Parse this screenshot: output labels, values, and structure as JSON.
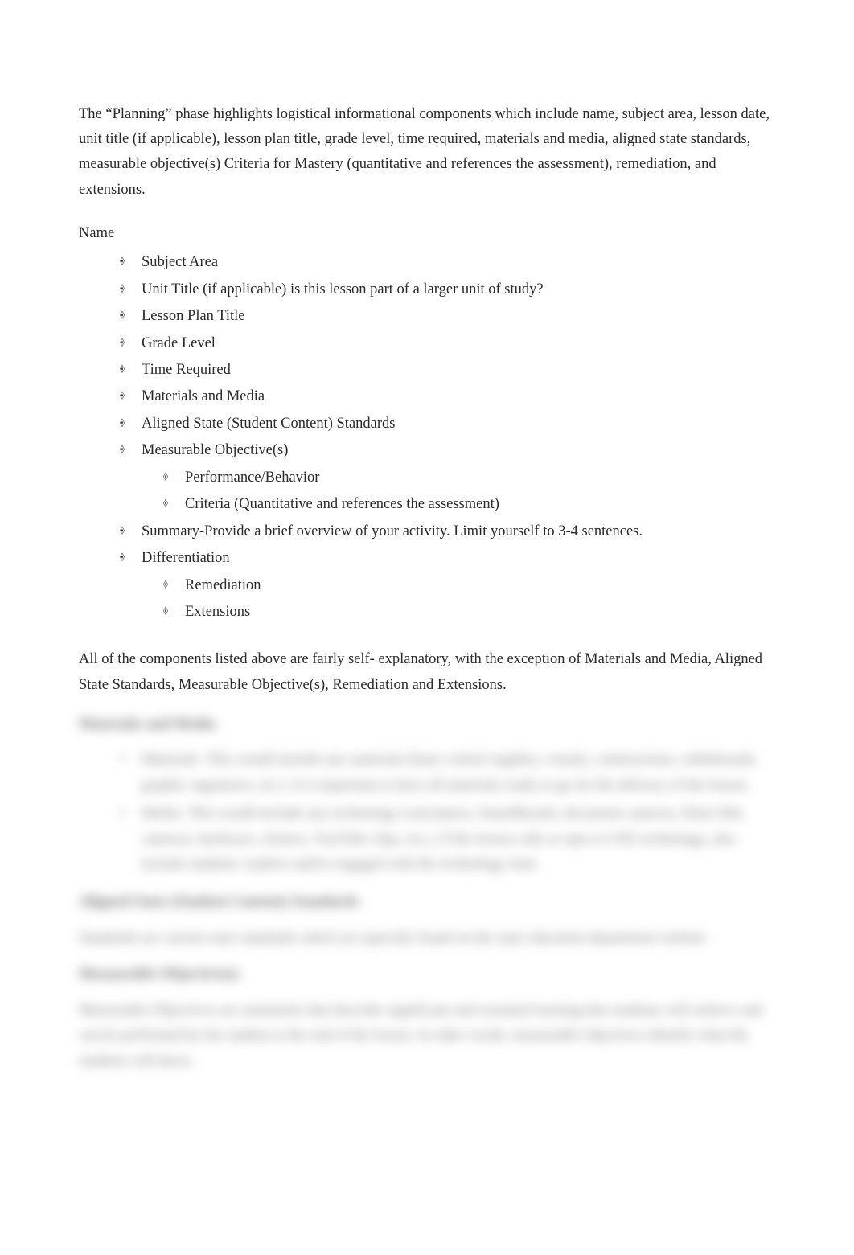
{
  "intro": "The “Planning” phase highlights logistical informational components which include name, subject area, lesson date, unit title (if applicable), lesson plan title, grade level, time required, materials and media, aligned state standards, measurable objective(s) Criteria for Mastery (quantitative and references the assessment), remediation, and extensions.",
  "name_label": "Name",
  "list1": {
    "item0": "Subject Area",
    "item1": "Unit Title (if applicable) is this lesson part of a larger unit of study?",
    "item2": "Lesson Plan Title",
    "item3": "Grade Level",
    "item4": "Time Required",
    "item5": "Materials and Media",
    "item6": "Aligned State (Student Content) Standards",
    "item7": "Measurable Objective(s)",
    "item7_sub": {
      "s0": "Performance/Behavior",
      "s1": "Criteria (Quantitative and references the assessment)"
    },
    "item8": "Summary-Provide a brief overview of your activity. Limit yourself to 3-4 sentences.",
    "item9": "Differentiation",
    "item9_sub": {
      "s0": "Remediation",
      "s1": "Extensions"
    }
  },
  "para2": "All of the components listed above are fairly self- explanatory, with the exception of Materials and Media, Aligned State Standards, Measurable Objective(s), Remediation and Extensions.",
  "blurred": {
    "h1": "Materials and Media",
    "b1_li0": "Materials- This would include any materials (basic school supplies, visuals, constructions, whiteboards, graphic organizers, etc.). It is important to have all materials ready to go for the delivery of the lesson.",
    "b1_li1": "Media- This would include any technology (calculators, SmartBoards, document cameras, Elmo film cameras, hardware, clickers, YouTube clips, etc.). If the lesson calls or opts to USE technology, also include students' explicit and/or engaged with the technology item.",
    "h2": "Aligned State (Student Content) Standards",
    "b2": "Standards are current state standards which are typically found on the state education department website.",
    "h3": "Measurable Objective(s)",
    "b3": "Measurable Objectives are statements that describe significant and essential learning that students will achieve and can be performed by the student at the end of the lesson. In other words, measurable objectives identify what the students will know."
  }
}
